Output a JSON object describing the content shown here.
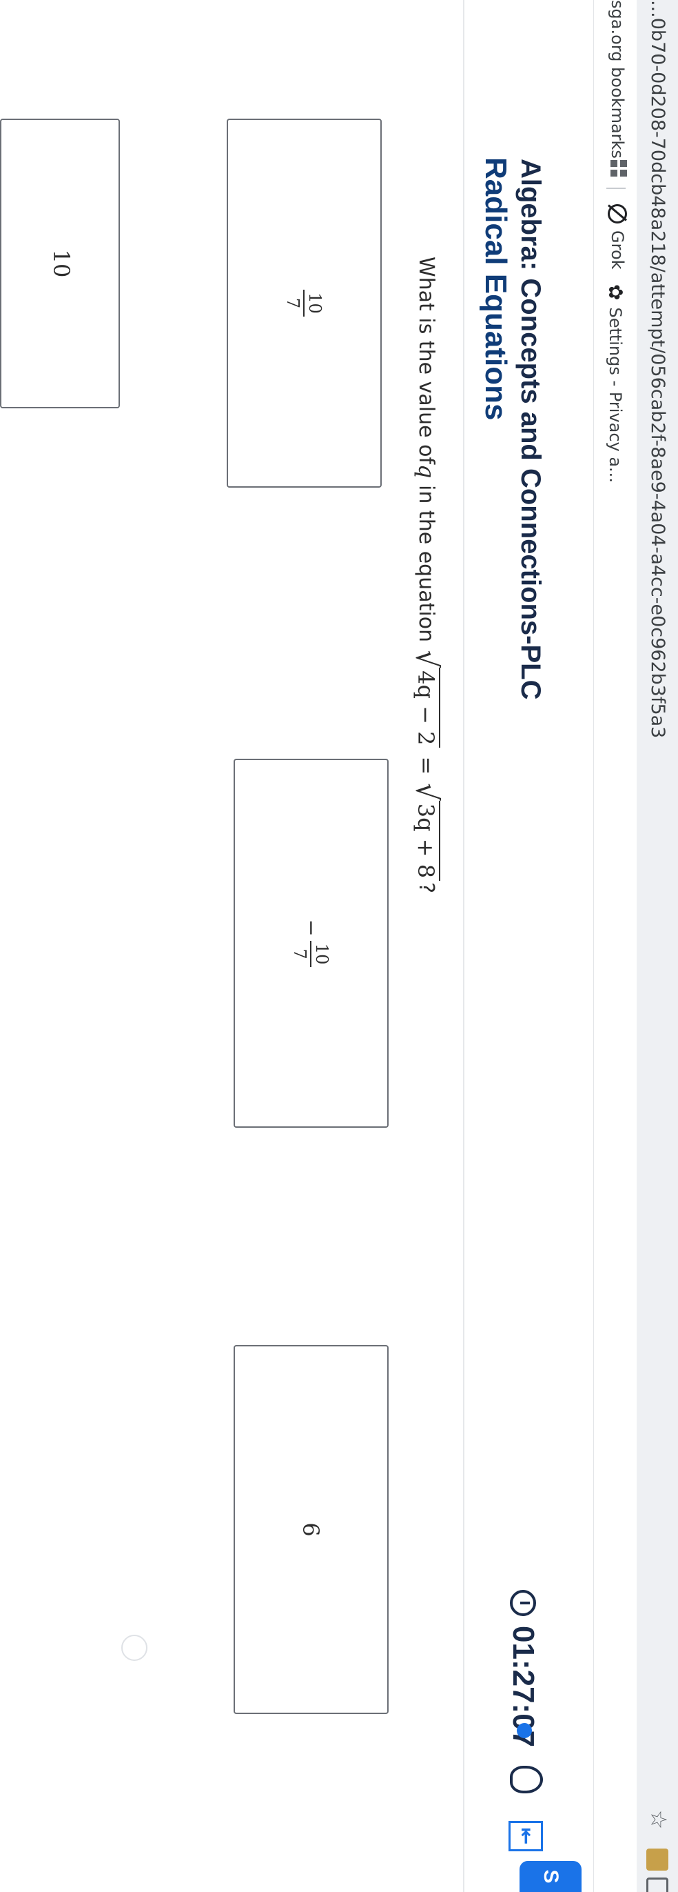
{
  "browser": {
    "url": "...0b70-0d208-70dcb48a218/attempt/056cab2f-8ae9-4a04-a4cc-e0c962b3f5a3",
    "star_icon": "star-icon"
  },
  "bookmarks": {
    "bookmarks_label": "sga.org bookmarks",
    "apps_icon": "apps-grid-icon",
    "grok_label": "Grok",
    "grok_icon": "grok-icon",
    "settings_label": "Settings - Privacy a...",
    "settings_icon": "gear-icon"
  },
  "header": {
    "course_title": "Algebra: Concepts and Connections-PLC",
    "lesson_title": "Radical Equations",
    "timer": "01:27:07",
    "clock_icon": "clock-icon",
    "hint_icon": "hint-lightbulb-icon",
    "reader_icon": "reader-icon",
    "corner_tab_label": "S"
  },
  "question": {
    "prefix": "What is the value of ",
    "variable": "q",
    "middle": " in the equation ",
    "lhs_radicand": "4q − 2",
    "equals": "=",
    "rhs_radicand": "3q + 8",
    "suffix": "?"
  },
  "choices": [
    {
      "id": "a",
      "sign": "",
      "numerator": "10",
      "denominator": "7"
    },
    {
      "id": "b",
      "sign": "−",
      "numerator": "10",
      "denominator": "7"
    },
    {
      "id": "c",
      "value": "6"
    },
    {
      "id": "d",
      "value": "10"
    }
  ],
  "colors": {
    "accent": "#1a73e8",
    "title": "#1a2b4a",
    "lesson": "#0f3c78"
  }
}
